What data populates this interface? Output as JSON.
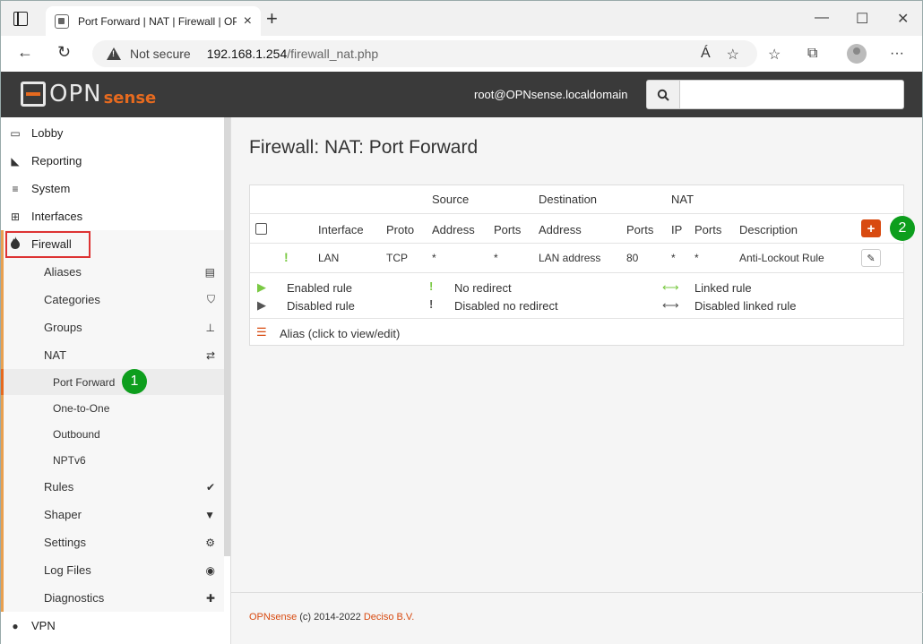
{
  "browser": {
    "tab_title": "Port Forward | NAT | Firewall | OP",
    "tab_close": "×",
    "new_tab": "+",
    "window_controls": {
      "minimize": "—",
      "maximize": "☐",
      "close": "✕"
    },
    "security_label": "Not secure",
    "url_host": "192.168.1.254",
    "url_path": "/firewall_nat.php",
    "nav_back": "←",
    "nav_reload": "↻",
    "read_aloud": "Á",
    "more_menu": "···"
  },
  "header": {
    "logo_main": "OPN",
    "logo_suffix": "sense",
    "user": "root@OPNsense.localdomain",
    "search_placeholder": ""
  },
  "sidebar": {
    "items": [
      {
        "label": "Lobby",
        "icon": "laptop-icon",
        "glyph": "▭"
      },
      {
        "label": "Reporting",
        "icon": "area-chart-icon",
        "glyph": "◣"
      },
      {
        "label": "System",
        "icon": "server-icon",
        "glyph": "≡"
      },
      {
        "label": "Interfaces",
        "icon": "sitemap-icon",
        "glyph": "⊞"
      },
      {
        "label": "Firewall",
        "icon": "fire-icon",
        "glyph": "🔥"
      }
    ],
    "firewall_sub": [
      {
        "label": "Aliases",
        "glyph": "▤"
      },
      {
        "label": "Categories",
        "glyph": "⛉"
      },
      {
        "label": "Groups",
        "glyph": "⊥"
      },
      {
        "label": "NAT",
        "glyph": "⇄"
      }
    ],
    "nat_sub": [
      {
        "label": "Port Forward"
      },
      {
        "label": "One-to-One"
      },
      {
        "label": "Outbound"
      },
      {
        "label": "NPTv6"
      }
    ],
    "firewall_sub2": [
      {
        "label": "Rules",
        "glyph": "✔"
      },
      {
        "label": "Shaper",
        "glyph": "▼"
      },
      {
        "label": "Settings",
        "glyph": "⚙"
      },
      {
        "label": "Log Files",
        "glyph": "◉"
      },
      {
        "label": "Diagnostics",
        "glyph": "✚"
      }
    ],
    "vpn": {
      "label": "VPN",
      "glyph": "●"
    }
  },
  "badges": {
    "one": "1",
    "two": "2"
  },
  "main": {
    "title": "Firewall: NAT: Port Forward",
    "group_headers": {
      "source": "Source",
      "destination": "Destination",
      "nat": "NAT"
    },
    "columns": {
      "interface": "Interface",
      "proto": "Proto",
      "src_address": "Address",
      "src_ports": "Ports",
      "dst_address": "Address",
      "dst_ports": "Ports",
      "nat_ip": "IP",
      "nat_ports": "Ports",
      "description": "Description"
    },
    "rows": [
      {
        "status_glyph": "!",
        "interface": "LAN",
        "proto": "TCP",
        "src_address": "*",
        "src_ports": "*",
        "dst_address": "LAN address",
        "dst_ports": "80",
        "nat_ip": "*",
        "nat_ports": "*",
        "description": "Anti-Lockout Rule"
      }
    ],
    "add_label": "+",
    "edit_label": "✎",
    "legend": {
      "enabled_rule": "Enabled rule",
      "disabled_rule": "Disabled rule",
      "no_redirect": "No redirect",
      "disabled_no_redirect": "Disabled no redirect",
      "linked_rule": "Linked rule",
      "disabled_linked_rule": "Disabled linked rule",
      "alias": "Alias (click to view/edit)",
      "glyph_play": "▶",
      "glyph_excl": "!",
      "glyph_link": "⟷",
      "glyph_list": "☰"
    },
    "footer": {
      "brand": "OPNsense",
      "text": " (c) 2014-2022 ",
      "company": "Deciso B.V."
    }
  },
  "colors": {
    "accent": "#d84a10",
    "green": "#0d9e1d",
    "light_green": "#7ac943",
    "header_bg": "#3a3a3a"
  }
}
